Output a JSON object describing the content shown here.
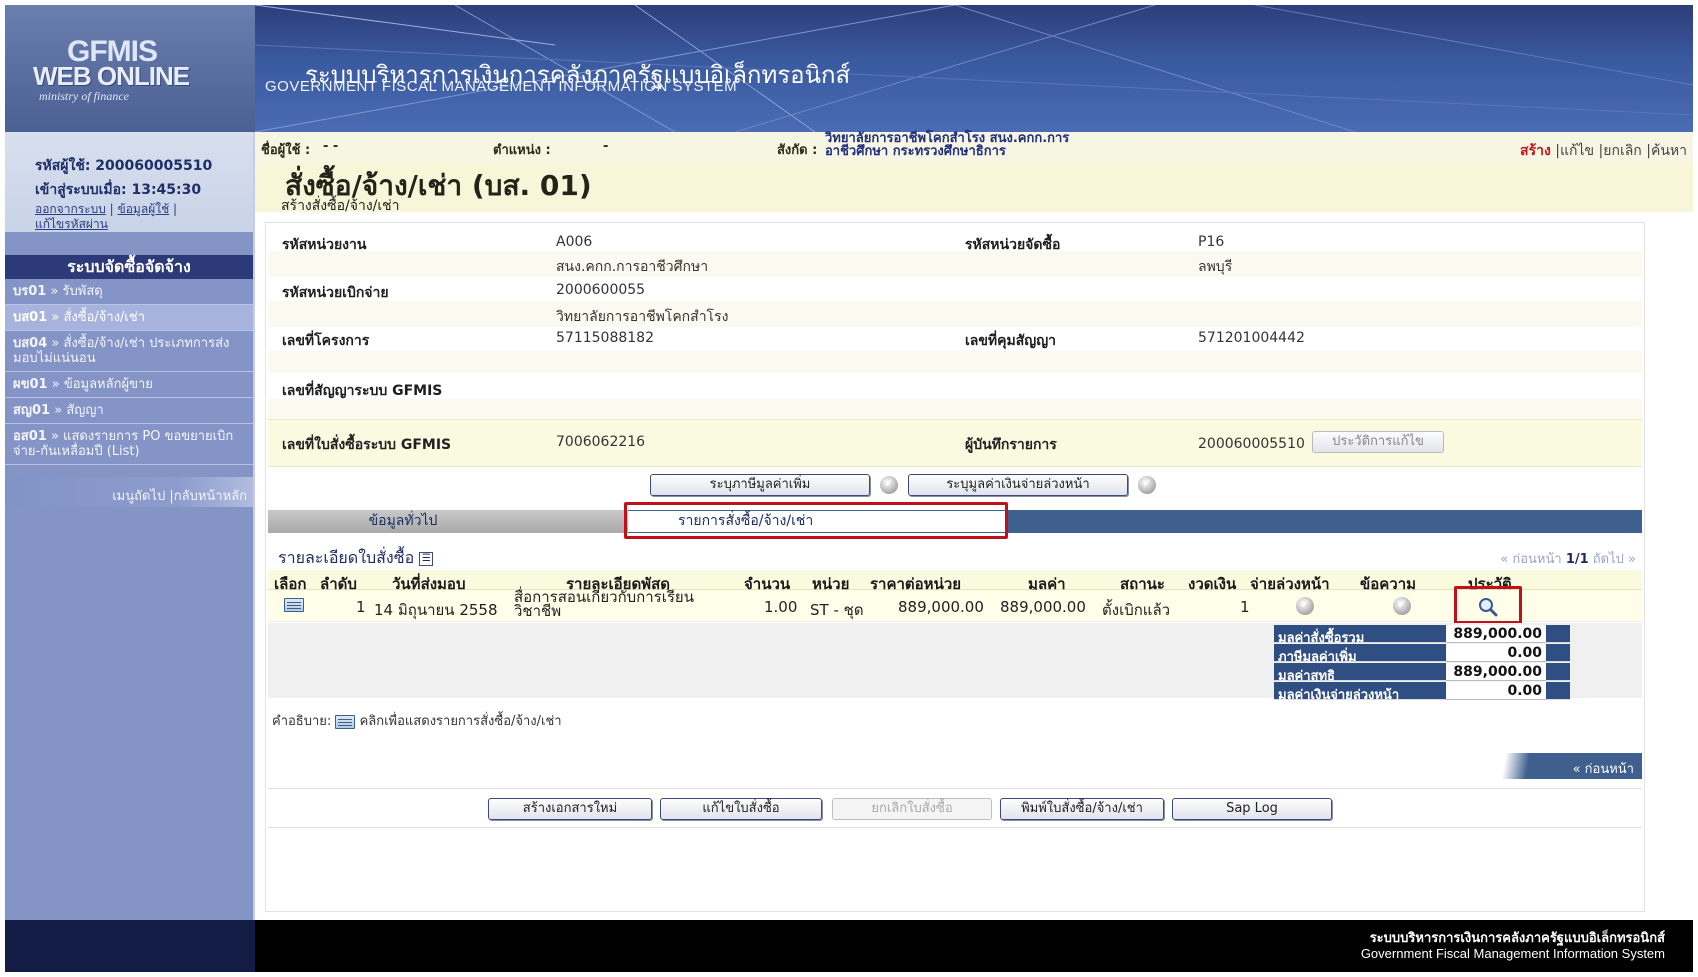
{
  "app": {
    "logo_line1": "GFMIS",
    "logo_line2": "WEB ONLINE",
    "logo_line3": "ministry of finance",
    "title_th": "ระบบบริหารการเงินการคลังภาครัฐแบบอิเล็กทรอนิกส์",
    "title_en": "GOVERNMENT FISCAL MANAGEMENT INFORMATION SYSTEM"
  },
  "user": {
    "user_id_label": "รหัสผู้ใช้: 200060005510",
    "login_time_label": "เข้าสู่ระบบเมื่อ: 13:45:30",
    "link_logout": "ออกจากระบบ",
    "link_userinfo": "ข้อมูลผู้ใช้",
    "link_changepw": "แก้ไขรหัสผ่าน",
    "sep": " | "
  },
  "menu": {
    "title": "ระบบจัดซื้อจัดจ้าง",
    "items": [
      {
        "code": "บร01",
        "label": " » รับพัสดุ"
      },
      {
        "code": "บส01",
        "label": " » สั่งซื้อ/จ้าง/เช่า"
      },
      {
        "code": "บส04",
        "label": " » สั่งซื้อ/จ้าง/เช่า ประเภทการส่งมอบไม่แน่นอน"
      },
      {
        "code": "ผข01",
        "label": " » ข้อมูลหลักผู้ขาย"
      },
      {
        "code": "สญ01",
        "label": " » สัญญา"
      },
      {
        "code": "อส01",
        "label": " » แสดงรายการ PO ขอขยายเบิกจ่าย-กันเหลื่อมปี (List)"
      }
    ],
    "footer": "เมนูถัดไป |กลับหน้าหลัก"
  },
  "topbar": {
    "username_label": "ชื่อผู้ใช้ :",
    "username_value": "- -",
    "position_label": "ตำแหน่ง :",
    "position_value": "-",
    "dept_label": "สังกัด :",
    "dept_line1": "วิทยาลัยการอาชีพโคกสำโรง สนง.คกก.การ",
    "dept_line2": "อาชีวศึกษา กระทรวงศึกษาธิการ",
    "action_create": "สร้าง",
    "action_edit": "แก้ไข",
    "action_cancel": "ยกเลิก",
    "action_search": "ค้นหา",
    "sep": " |"
  },
  "page": {
    "title": "สั่งซื้อ/จ้าง/เช่า (บส. 01)",
    "subtitle": "สร้างสั่งซื้อ/จ้าง/เช่า"
  },
  "form": {
    "unit_code_label": "รหัสหน่วยงาน",
    "unit_code_value": "A006",
    "unit_code_name": "สนง.คกก.การอาชีวศึกษา",
    "purchase_unit_label": "รหัสหน่วยจัดซื้อ",
    "purchase_unit_value": "P16",
    "purchase_unit_name": "ลพบุรี",
    "disb_unit_label": "รหัสหน่วยเบิกจ่าย",
    "disb_unit_value": "2000600055",
    "disb_unit_name": "วิทยาลัยการอาชีพโคกสำโรง",
    "project_no_label": "เลขที่โครงการ",
    "project_no_value": "57115088182",
    "contract_ctrl_label": "เลขที่คุมสัญญา",
    "contract_ctrl_value": "571201004442",
    "gf_contract_label": "เลขที่สัญญาระบบ GFMIS",
    "gf_po_label": "เลขที่ใบสั่งซื้อระบบ GFMIS",
    "gf_po_value": "7006062216",
    "recorder_label": "ผู้บันทึกรายการ",
    "recorder_value": "200060005510",
    "history_btn": "ประวัติการแก้ไข",
    "vat_btn": "ระบุภาษีมูลค่าเพิ่ม",
    "advance_btn": "ระบุมูลค่าเงินจ่ายล่วงหน้า"
  },
  "tabs": {
    "general": "ข้อมูลทั่วไป",
    "items": "รายการสั่งซื้อ/จ้าง/เช่า"
  },
  "detail": {
    "title": "รายละเอียดใบสั่งซื้อ",
    "pager_prev": "« ก่อนหน้า",
    "pager_page": "1/1",
    "pager_next": "ถัดไป »",
    "headers": {
      "select": "เลือก",
      "seq": "ลำดับ",
      "delivery": "วันที่ส่งมอบ",
      "desc": "รายละเอียดพัสดุ",
      "qty": "จำนวน",
      "unit": "หน่วย",
      "price": "ราคาต่อหน่วย",
      "value": "มูลค่า",
      "status": "สถานะ",
      "period": "งวดเงิน",
      "advance": "จ่ายล่วงหน้า",
      "message": "ข้อความ",
      "history": "ประวัติ"
    },
    "row": {
      "seq": "1",
      "delivery": "14 มิถุนายน 2558",
      "desc_line1": "สื่อการสอนเกี่ยวกับการเรียน",
      "desc_line2": "วิชาชีพ",
      "qty": "1.00",
      "unit": "ST - ชุด",
      "price": "889,000.00",
      "value": "889,000.00",
      "status": "ตั้งเบิกแล้ว",
      "period": "1"
    },
    "summary": [
      {
        "label": "มูลค่าสั่งซื้อรวม",
        "value": "889,000.00"
      },
      {
        "label": "ภาษีมูลค่าเพิ่ม",
        "value": "0.00"
      },
      {
        "label": "มูลค่าสุทธิ",
        "value": "889,000.00"
      },
      {
        "label": "มูลค่าเงินจ่ายล่วงหน้า",
        "value": "0.00"
      }
    ],
    "legend_label": "คำอธิบาย:",
    "legend_text": "คลิกเพื่อแสดงรายการสั่งซื้อ/จ้าง/เช่า",
    "prev_btn": "« ก่อนหน้า"
  },
  "buttons": {
    "new_doc": "สร้างเอกสารใหม่",
    "edit_po": "แก้ไขใบสั่งซื้อ",
    "cancel_po": "ยกเลิกใบสั่งซื้อ",
    "print_po": "พิมพ์ใบสั่งซื้อ/จ้าง/เช่า",
    "sap_log": "Sap Log"
  },
  "footer": {
    "line_th": "ระบบบริหารการเงินการคลังภาครัฐแบบอิเล็กทรอนิกส์",
    "line_en": "Government Fiscal Management Information System"
  },
  "colors": {
    "header_blue": "#3a5aa0",
    "sidebar": "#8495c5",
    "navy": "#2f4f83",
    "highlight_red": "#c0111b",
    "create_red": "#c0151b"
  }
}
